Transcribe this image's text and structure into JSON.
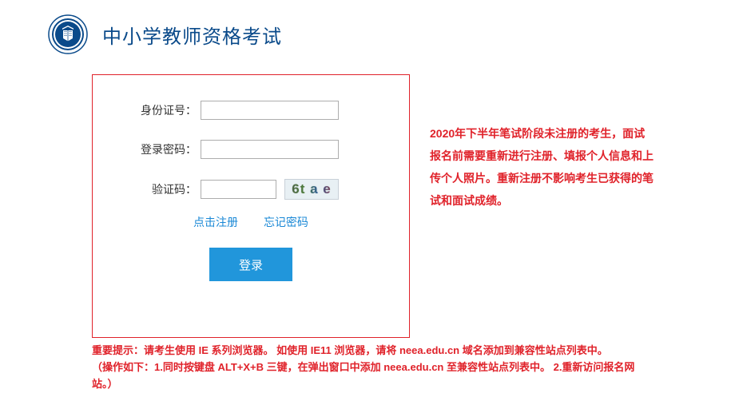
{
  "header": {
    "title": "中小学教师资格考试"
  },
  "form": {
    "id_label": "身份证号：",
    "id_value": "",
    "pw_label": "登录密码：",
    "pw_value": "",
    "captcha_label": "验证码：",
    "captcha_value": "",
    "captcha_text": "6t a e",
    "register_link": "点击注册",
    "forgot_link": "忘记密码",
    "login_button": "登录"
  },
  "side_notice": "2020年下半年笔试阶段未注册的考生，面试报名前需要重新进行注册、填报个人信息和上传个人照片。重新注册不影响考生已获得的笔试和面试成绩。",
  "bottom_notice_line1": "重要提示：请考生使用 IE 系列浏览器。 如使用 IE11 浏览器，请将 neea.edu.cn 域名添加到兼容性站点列表中。",
  "bottom_notice_line2": "（操作如下：1.同时按键盘 ALT+X+B 三键，在弹出窗口中添加 neea.edu.cn 至兼容性站点列表中。 2.重新访问报名网站。）"
}
